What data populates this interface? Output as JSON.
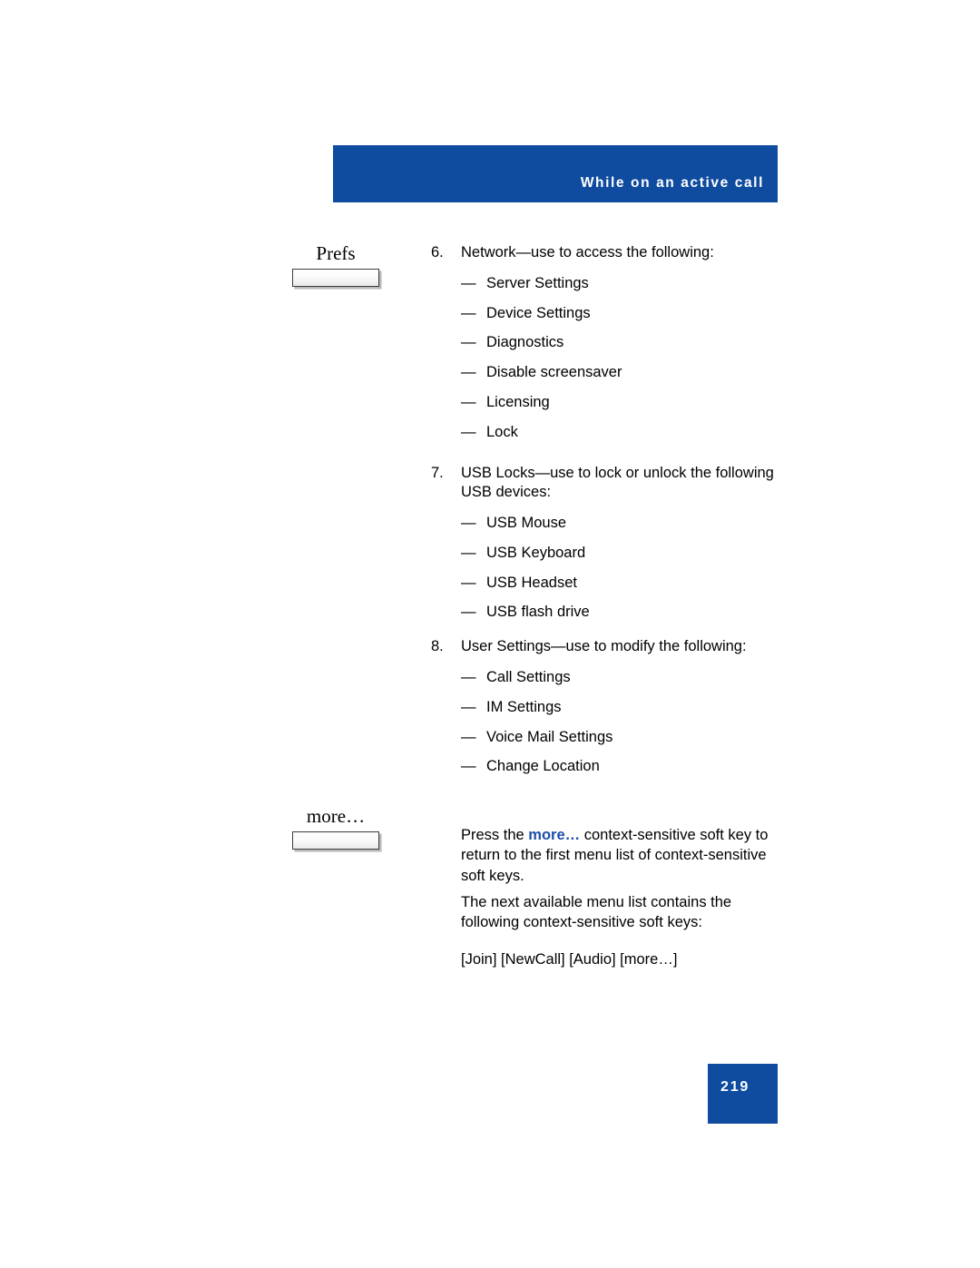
{
  "header": {
    "title": "While on an active call"
  },
  "callouts": [
    {
      "label": "Prefs",
      "key": "prefs-softkey"
    },
    {
      "label": "more…",
      "key": "more-softkey"
    }
  ],
  "body": {
    "items": [
      {
        "number": "6.",
        "text": "Network—use to access the following:",
        "sub_items": [
          "Server Settings",
          "Device Settings",
          "Diagnostics",
          "Disable screensaver",
          "Licensing",
          "Lock"
        ]
      },
      {
        "number": "7.",
        "text": "USB Locks—use to lock or unlock the following USB devices:",
        "sub_items": [
          "USB Mouse",
          "USB Keyboard",
          "USB Headset",
          "USB flash drive"
        ]
      },
      {
        "number": "8.",
        "text": "User Settings—use to modify the following:",
        "sub_items": [
          "Call Settings",
          "IM Settings",
          "Voice Mail Settings",
          "Change Location"
        ]
      }
    ],
    "dash_marker": "—"
  },
  "paragraphs": {
    "press_prefix": "Press the ",
    "press_emphasis": "more…",
    "press_suffix": " context-sensitive soft key to return to the first menu list of context-sensitive soft keys.",
    "next_available": "The next available menu list contains the following context-sensitive soft keys:",
    "softkey_line": "[Join] [NewCall] [Audio] [more…]"
  },
  "footer": {
    "page_number": "219"
  },
  "colors": {
    "brand_blue": "#0f4ca0",
    "emphasis_blue": "#1a4fa8"
  }
}
